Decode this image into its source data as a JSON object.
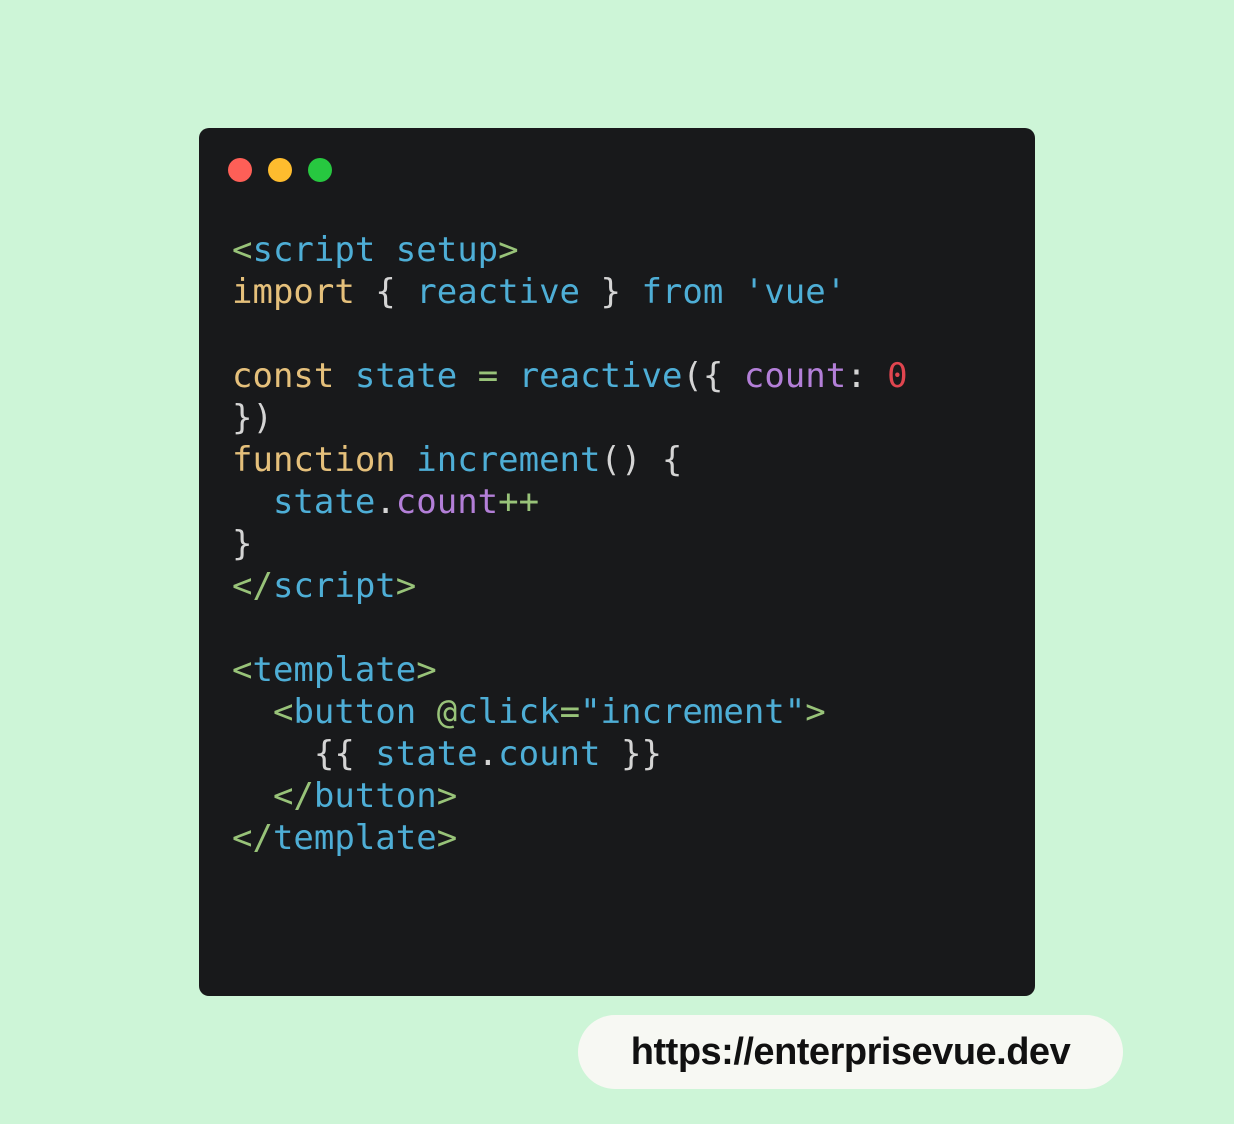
{
  "window": {
    "controls": [
      {
        "name": "close",
        "color": "#fe5f57"
      },
      {
        "name": "minimize",
        "color": "#febc2e"
      },
      {
        "name": "maximize",
        "color": "#27c840"
      }
    ]
  },
  "code": {
    "language": "vue",
    "lines": [
      [
        {
          "t": "<",
          "c": "green"
        },
        {
          "t": "script",
          "c": "blue"
        },
        {
          "t": " ",
          "c": "plain"
        },
        {
          "t": "setup",
          "c": "blue"
        },
        {
          "t": ">",
          "c": "green"
        }
      ],
      [
        {
          "t": "import",
          "c": "yellow"
        },
        {
          "t": " { ",
          "c": "plain"
        },
        {
          "t": "reactive",
          "c": "blue"
        },
        {
          "t": " } ",
          "c": "plain"
        },
        {
          "t": "from",
          "c": "blue"
        },
        {
          "t": " ",
          "c": "plain"
        },
        {
          "t": "'vue'",
          "c": "blue"
        }
      ],
      [],
      [
        {
          "t": "const",
          "c": "yellow"
        },
        {
          "t": " ",
          "c": "plain"
        },
        {
          "t": "state",
          "c": "blue"
        },
        {
          "t": " ",
          "c": "plain"
        },
        {
          "t": "=",
          "c": "green"
        },
        {
          "t": " ",
          "c": "plain"
        },
        {
          "t": "reactive",
          "c": "blue"
        },
        {
          "t": "({ ",
          "c": "plain"
        },
        {
          "t": "count",
          "c": "purple"
        },
        {
          "t": ": ",
          "c": "plain"
        },
        {
          "t": "0",
          "c": "red"
        }
      ],
      [
        {
          "t": "})",
          "c": "plain"
        }
      ],
      [
        {
          "t": "function",
          "c": "yellow"
        },
        {
          "t": " ",
          "c": "plain"
        },
        {
          "t": "increment",
          "c": "blue"
        },
        {
          "t": "() {",
          "c": "plain"
        }
      ],
      [
        {
          "t": "  ",
          "c": "plain"
        },
        {
          "t": "state",
          "c": "blue"
        },
        {
          "t": ".",
          "c": "plain"
        },
        {
          "t": "count",
          "c": "purple"
        },
        {
          "t": "++",
          "c": "green"
        }
      ],
      [
        {
          "t": "}",
          "c": "plain"
        }
      ],
      [
        {
          "t": "</",
          "c": "green"
        },
        {
          "t": "script",
          "c": "blue"
        },
        {
          "t": ">",
          "c": "green"
        }
      ],
      [],
      [
        {
          "t": "<",
          "c": "green"
        },
        {
          "t": "template",
          "c": "blue"
        },
        {
          "t": ">",
          "c": "green"
        }
      ],
      [
        {
          "t": "  ",
          "c": "plain"
        },
        {
          "t": "<",
          "c": "green"
        },
        {
          "t": "button",
          "c": "blue"
        },
        {
          "t": " ",
          "c": "plain"
        },
        {
          "t": "@",
          "c": "green"
        },
        {
          "t": "click",
          "c": "blue"
        },
        {
          "t": "=",
          "c": "green"
        },
        {
          "t": "\"increment\"",
          "c": "blue"
        },
        {
          "t": ">",
          "c": "green"
        }
      ],
      [
        {
          "t": "    {{ ",
          "c": "plain"
        },
        {
          "t": "state",
          "c": "blue"
        },
        {
          "t": ".",
          "c": "plain"
        },
        {
          "t": "count",
          "c": "blue"
        },
        {
          "t": " }}",
          "c": "plain"
        }
      ],
      [
        {
          "t": "  ",
          "c": "plain"
        },
        {
          "t": "</",
          "c": "green"
        },
        {
          "t": "button",
          "c": "blue"
        },
        {
          "t": ">",
          "c": "green"
        }
      ],
      [
        {
          "t": "</",
          "c": "green"
        },
        {
          "t": "template",
          "c": "blue"
        },
        {
          "t": ">",
          "c": "green"
        }
      ]
    ]
  },
  "footer": {
    "url": "https://enterprisevue.dev"
  },
  "colors": {
    "background": "#cdf5d7",
    "window": "#18191b",
    "green": "#98c379",
    "blue": "#4eaed6",
    "yellow": "#e5c07b",
    "purple": "#b37fd8",
    "red": "#e0454f",
    "plain": "#d4d4d4"
  }
}
